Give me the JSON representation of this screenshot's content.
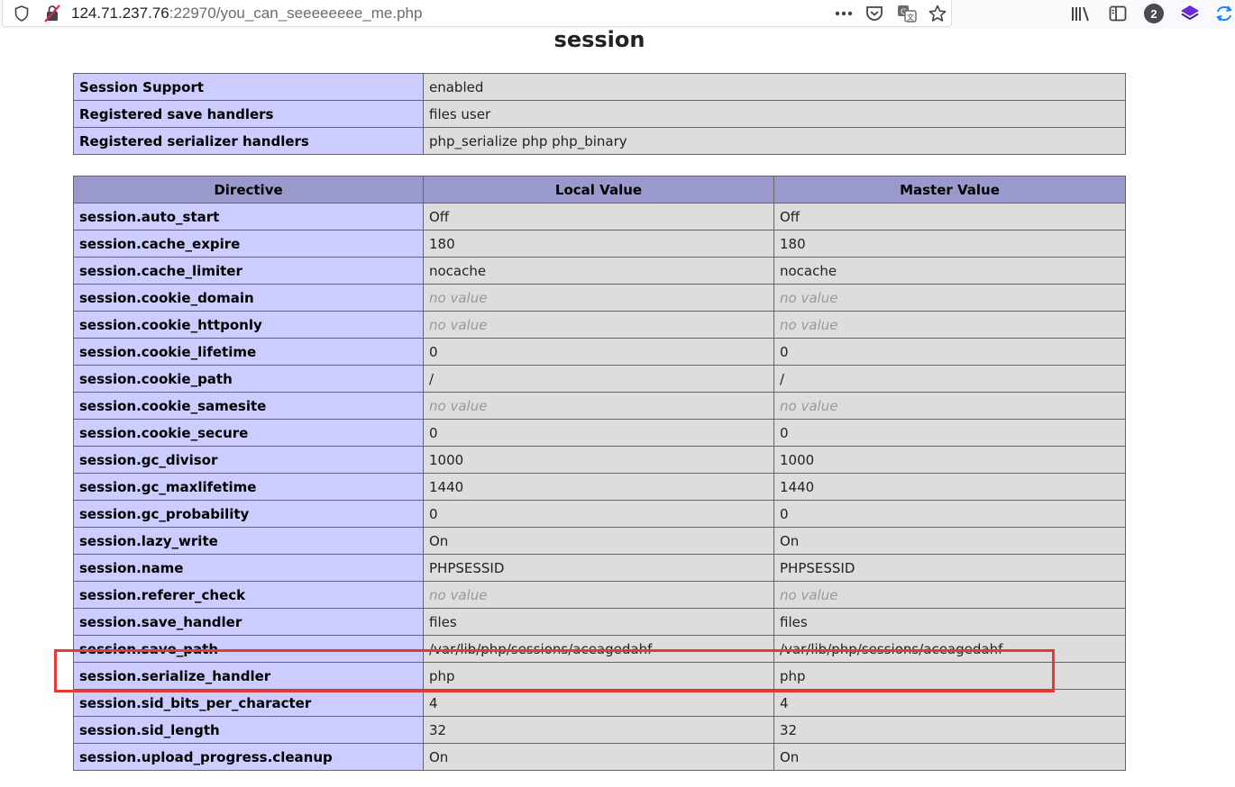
{
  "browser": {
    "url_host": "124.71.237.76",
    "url_rest": ":22970/you_can_seeeeeeee_me.php",
    "badge_count": "2",
    "icons": [
      "shield-icon",
      "insecure-lock-icon",
      "more-icon",
      "pocket-icon",
      "translate-icon",
      "bookmark-star-icon",
      "library-icon",
      "sidebar-icon",
      "account-badge-icon",
      "extension-icon",
      "sync-icon"
    ]
  },
  "page": {
    "title": "session"
  },
  "support_table": [
    {
      "name": "Session Support",
      "value": "enabled"
    },
    {
      "name": "Registered save handlers",
      "value": "files user"
    },
    {
      "name": "Registered serializer handlers",
      "value": "php_serialize php php_binary"
    }
  ],
  "directives_table": {
    "headers": [
      "Directive",
      "Local Value",
      "Master Value"
    ],
    "no_value_text": "no value",
    "rows": [
      {
        "directive": "session.auto_start",
        "local": "Off",
        "master": "Off"
      },
      {
        "directive": "session.cache_expire",
        "local": "180",
        "master": "180"
      },
      {
        "directive": "session.cache_limiter",
        "local": "nocache",
        "master": "nocache"
      },
      {
        "directive": "session.cookie_domain",
        "local": "no value",
        "master": "no value"
      },
      {
        "directive": "session.cookie_httponly",
        "local": "no value",
        "master": "no value"
      },
      {
        "directive": "session.cookie_lifetime",
        "local": "0",
        "master": "0"
      },
      {
        "directive": "session.cookie_path",
        "local": "/",
        "master": "/"
      },
      {
        "directive": "session.cookie_samesite",
        "local": "no value",
        "master": "no value"
      },
      {
        "directive": "session.cookie_secure",
        "local": "0",
        "master": "0"
      },
      {
        "directive": "session.gc_divisor",
        "local": "1000",
        "master": "1000"
      },
      {
        "directive": "session.gc_maxlifetime",
        "local": "1440",
        "master": "1440"
      },
      {
        "directive": "session.gc_probability",
        "local": "0",
        "master": "0"
      },
      {
        "directive": "session.lazy_write",
        "local": "On",
        "master": "On"
      },
      {
        "directive": "session.name",
        "local": "PHPSESSID",
        "master": "PHPSESSID"
      },
      {
        "directive": "session.referer_check",
        "local": "no value",
        "master": "no value"
      },
      {
        "directive": "session.save_handler",
        "local": "files",
        "master": "files"
      },
      {
        "directive": "session.save_path",
        "local": "/var/lib/php/sessions/aceagedahf",
        "master": "/var/lib/php/sessions/aceagedahf"
      },
      {
        "directive": "session.serialize_handler",
        "local": "php",
        "master": "php"
      },
      {
        "directive": "session.sid_bits_per_character",
        "local": "4",
        "master": "4"
      },
      {
        "directive": "session.sid_length",
        "local": "32",
        "master": "32"
      },
      {
        "directive": "session.upload_progress.cleanup",
        "local": "On",
        "master": "On"
      }
    ]
  },
  "annotation": {
    "highlight_color": "#e53935",
    "highlighted_directive": "session.save_path"
  }
}
